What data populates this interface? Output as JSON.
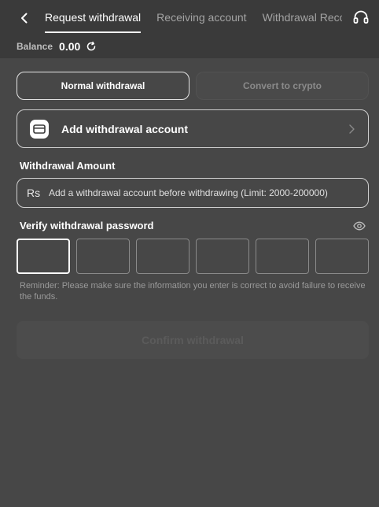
{
  "header": {
    "tabs": [
      {
        "label": "Request withdrawal",
        "active": true
      },
      {
        "label": "Receiving account",
        "active": false
      },
      {
        "label": "Withdrawal Records",
        "active": false
      }
    ],
    "back_icon": "chevron-left-icon",
    "support_icon": "headset-icon"
  },
  "balance": {
    "label": "Balance",
    "value": "0.00"
  },
  "mode": {
    "normal_label": "Normal withdrawal",
    "crypto_label": "Convert to crypto"
  },
  "account": {
    "add_label": "Add withdrawal account"
  },
  "amount": {
    "title": "Withdrawal Amount",
    "currency": "Rs",
    "placeholder": "Add a withdrawal account before withdrawing (Limit: 2000-200000)"
  },
  "password": {
    "title": "Verify withdrawal password",
    "digits": 6
  },
  "reminder": "Reminder: Please make sure the information you enter is correct to avoid failure to receive the funds.",
  "confirm_label": "Confirm withdrawal",
  "colors": {
    "background": "#474747",
    "header": "#3a3a3a",
    "text": "#ffffff",
    "muted": "#9a9a9a"
  }
}
